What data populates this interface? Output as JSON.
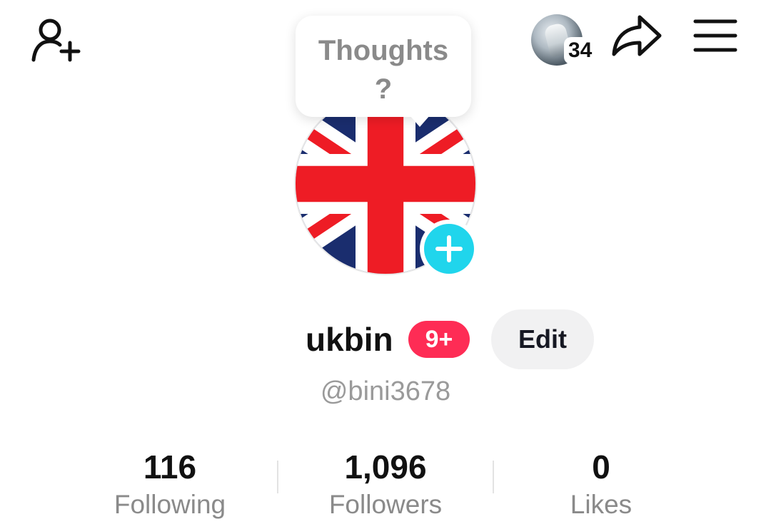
{
  "header": {
    "stories_count": "34"
  },
  "thoughts_bubble": {
    "text": "Thoughts ?"
  },
  "profile": {
    "username": "ukbin",
    "notification_badge": "9+",
    "handle": "@bini3678",
    "edit_label": "Edit"
  },
  "stats": [
    {
      "value": "116",
      "label": "Following"
    },
    {
      "value": "1,096",
      "label": "Followers"
    },
    {
      "value": "0",
      "label": "Likes"
    }
  ],
  "colors": {
    "badge": "#fe2c55",
    "add_story": "#20d5ec",
    "edit_button_bg": "#f1f1f2",
    "flag_red": "#ee1c25",
    "flag_blue": "#1a2d6e"
  },
  "icons": {
    "add_friend": "add-friend-icon",
    "share": "share-icon",
    "menu": "hamburger-menu-icon",
    "add_story": "plus-icon"
  }
}
